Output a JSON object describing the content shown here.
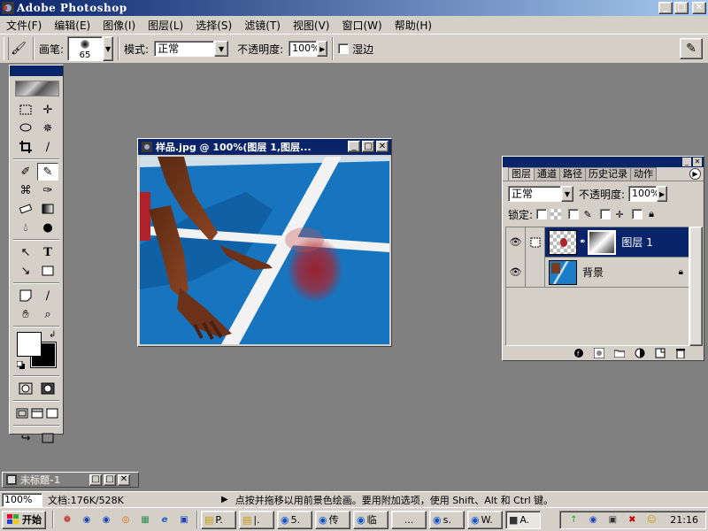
{
  "app": {
    "title": "Adobe Photoshop",
    "window_buttons": [
      "_",
      "□",
      "✕"
    ]
  },
  "menu": [
    "文件(F)",
    "编辑(E)",
    "图像(I)",
    "图层(L)",
    "选择(S)",
    "滤镜(T)",
    "视图(V)",
    "窗口(W)",
    "帮助(H)"
  ],
  "options": {
    "brush_label": "画笔:",
    "brush_size": "65",
    "mode_label": "模式:",
    "mode_value": "正常",
    "opacity_label": "不透明度:",
    "opacity_value": "100%",
    "wet_edges_label": "湿边"
  },
  "toolbox": {
    "tools": [
      "rectangular-marquee-icon",
      "move-icon",
      "lasso-icon",
      "magic-wand-icon",
      "crop-icon",
      "slice-icon",
      "healing-brush-icon",
      "brush-icon",
      "clone-stamp-icon",
      "history-brush-icon",
      "eraser-icon",
      "gradient-icon",
      "blur-icon",
      "dodge-icon",
      "path-selection-icon",
      "type-icon",
      "pen-icon",
      "shape-icon",
      "notes-icon",
      "eyedropper-icon",
      "hand-icon",
      "zoom-icon"
    ],
    "foreground_color": "#ffffff",
    "background_color": "#000000"
  },
  "document": {
    "title": "样品.jpg @ 100%(图层 1,图层...",
    "colors": {
      "track_blue": "#1b7cc8",
      "line_white": "#f2f2f2",
      "skin": "#7a3b1e",
      "red_spot": "#b0222a"
    }
  },
  "layers_panel": {
    "tabs": [
      "图层",
      "通道",
      "路径",
      "历史记录",
      "动作"
    ],
    "active_tab": "图层",
    "blend_mode": "正常",
    "opacity_label": "不透明度:",
    "opacity_value": "100%",
    "lock_label": "锁定:",
    "layers": [
      {
        "name": "图层 1",
        "selected": true,
        "visible": true
      },
      {
        "name": "背景",
        "selected": false,
        "visible": true,
        "locked": true
      }
    ]
  },
  "minimized_doc": {
    "title": "未标题-1"
  },
  "status": {
    "zoom": "100%",
    "doc_size": "文档:176K/528K",
    "hint": "点按并拖移以用前景色绘画。要用附加选项，使用 Shift、Alt 和 Ctrl 键。"
  },
  "taskbar": {
    "start_label": "开始",
    "buttons": [
      "P.",
      "|.",
      "5.",
      "传",
      "临",
      "...",
      "s.",
      "W.",
      "A."
    ],
    "clock": "21:16"
  }
}
